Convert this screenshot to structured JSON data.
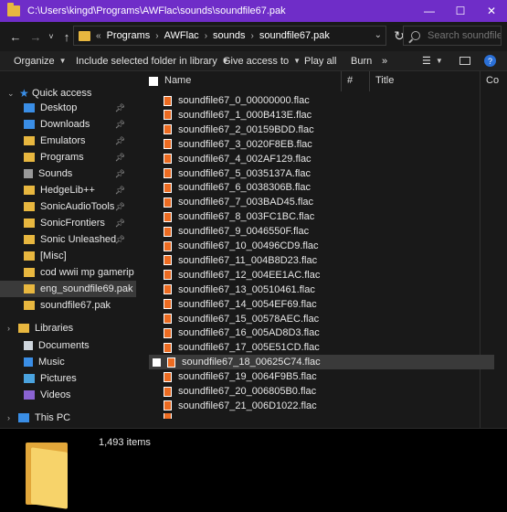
{
  "window": {
    "title": "C:\\Users\\kingd\\Programs\\AWFlac\\sounds\\soundfile67.pak",
    "minimize": "—",
    "maximize": "☐",
    "close": "✕"
  },
  "nav": {
    "back": "←",
    "forward": "→",
    "recent": "˅",
    "up": "↑",
    "breadcrumbs": [
      "«",
      "Programs",
      "AWFlac",
      "sounds",
      "soundfile67.pak"
    ],
    "search_placeholder": "Search soundfile6..."
  },
  "toolbar": {
    "organize": "Organize",
    "include": "Include selected folder in library",
    "give_access": "Give access to",
    "play_all": "Play all",
    "burn": "Burn",
    "more": "»"
  },
  "sidebar": {
    "quick_access": "Quick access",
    "items": [
      {
        "label": "Desktop",
        "icon": "desktop-icon",
        "pinned": true
      },
      {
        "label": "Downloads",
        "icon": "downloads-icon",
        "pinned": true
      },
      {
        "label": "Emulators",
        "icon": "folder-icon",
        "pinned": true
      },
      {
        "label": "Programs",
        "icon": "folder-icon",
        "pinned": true
      },
      {
        "label": "Sounds",
        "icon": "speaker-icon",
        "pinned": true
      },
      {
        "label": "HedgeLib++",
        "icon": "folder-icon",
        "pinned": true
      },
      {
        "label": "SonicAudioTools",
        "icon": "folder-icon",
        "pinned": true
      },
      {
        "label": "SonicFrontiers",
        "icon": "folder-icon",
        "pinned": true
      },
      {
        "label": "Sonic Unleashed (USA",
        "icon": "folder-icon",
        "pinned": true
      },
      {
        "label": "[Misc]",
        "icon": "folder-icon",
        "pinned": false
      },
      {
        "label": "cod wwii mp gamerip",
        "icon": "folder-icon",
        "pinned": false
      },
      {
        "label": "eng_soundfile69.pak",
        "icon": "folder-icon",
        "pinned": false
      },
      {
        "label": "soundfile67.pak",
        "icon": "folder-icon",
        "pinned": false
      }
    ],
    "libraries": "Libraries",
    "library_items": [
      {
        "label": "Documents",
        "icon": "documents-icon"
      },
      {
        "label": "Music",
        "icon": "music-icon"
      },
      {
        "label": "Pictures",
        "icon": "pictures-icon"
      },
      {
        "label": "Videos",
        "icon": "videos-icon"
      }
    ],
    "this_pc": "This PC"
  },
  "columns": {
    "name": "Name",
    "number": "#",
    "title": "Title",
    "contributing": "Co"
  },
  "files": [
    "soundfile67_0_00000000.flac",
    "soundfile67_1_000B413E.flac",
    "soundfile67_2_00159BDD.flac",
    "soundfile67_3_0020F8EB.flac",
    "soundfile67_4_002AF129.flac",
    "soundfile67_5_0035137A.flac",
    "soundfile67_6_0038306B.flac",
    "soundfile67_7_003BAD45.flac",
    "soundfile67_8_003FC1BC.flac",
    "soundfile67_9_0046550F.flac",
    "soundfile67_10_00496CD9.flac",
    "soundfile67_11_004B8D23.flac",
    "soundfile67_12_004EE1AC.flac",
    "soundfile67_13_00510461.flac",
    "soundfile67_14_0054EF69.flac",
    "soundfile67_15_00578AEC.flac",
    "soundfile67_16_005AD8D3.flac",
    "soundfile67_17_005E51CD.flac",
    "soundfile67_18_00625C74.flac",
    "soundfile67_19_0064F9B5.flac",
    "soundfile67_20_006805B0.flac",
    "soundfile67_21_006D1022.flac"
  ],
  "selected_index": 18,
  "details": {
    "item_count": "1,493 items"
  },
  "colors": {
    "titlebar": "#6f2dc8",
    "folder": "#e8b73f",
    "flac_icon": "#ec6b21",
    "selection": "#3a3a3a"
  }
}
